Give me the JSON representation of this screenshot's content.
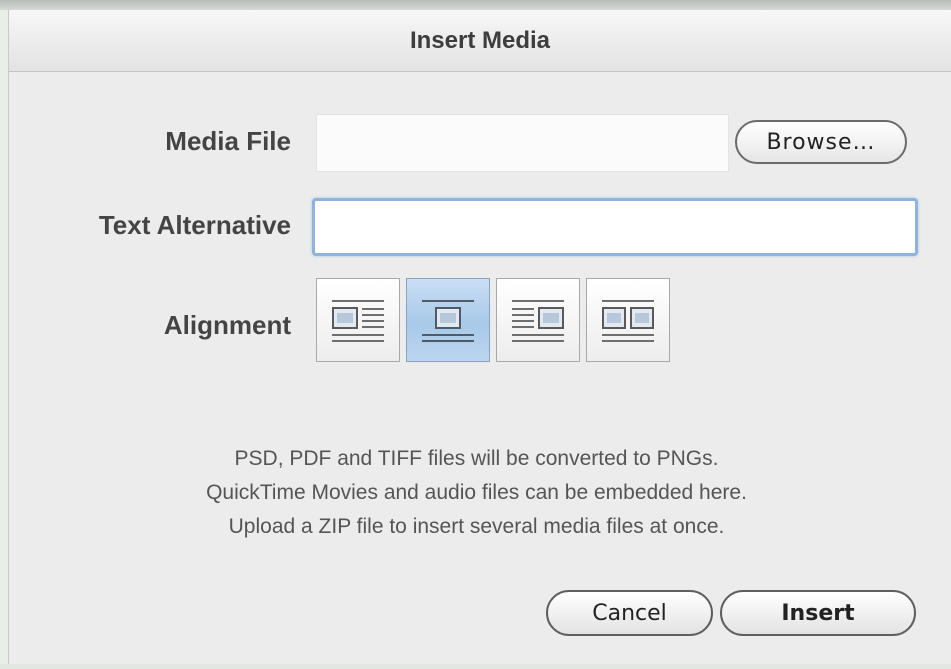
{
  "dialog": {
    "title": "Insert Media"
  },
  "form": {
    "media_file_label": "Media File",
    "media_file_value": "",
    "browse_label": "Browse…",
    "text_alt_label": "Text Alternative",
    "text_alt_value": "",
    "alignment_label": "Alignment",
    "alignment_options": [
      {
        "name": "align-left",
        "icon": "image-left-text-right-icon",
        "selected": false
      },
      {
        "name": "align-center",
        "icon": "image-center-icon",
        "selected": true
      },
      {
        "name": "align-right",
        "icon": "image-right-text-left-icon",
        "selected": false
      },
      {
        "name": "align-double",
        "icon": "two-images-icon",
        "selected": false
      }
    ]
  },
  "info": {
    "lines": [
      "PSD, PDF and TIFF files will be converted to PNGs.",
      "QuickTime Movies and audio files can be embedded here.",
      "Upload a ZIP file to insert several media files at once."
    ]
  },
  "buttons": {
    "cancel_label": "Cancel",
    "insert_label": "Insert"
  },
  "colors": {
    "selected_alignment": "#a9c9ea",
    "focus_ring": "#8fb3dd"
  }
}
